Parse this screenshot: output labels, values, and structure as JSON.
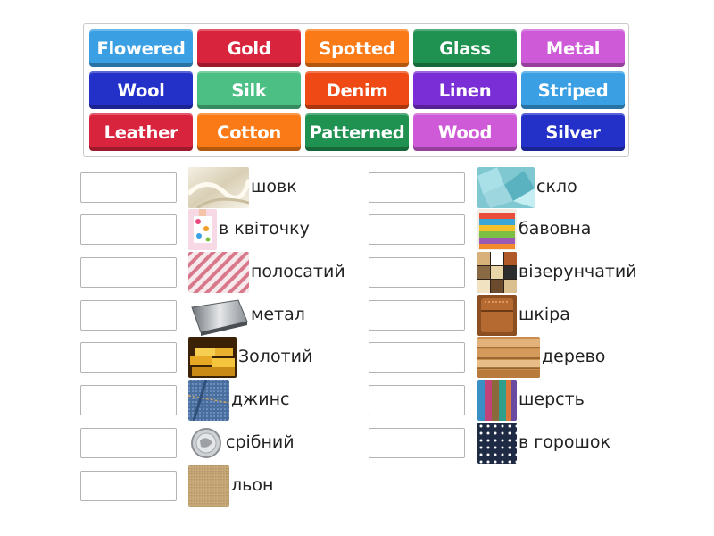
{
  "tiles": [
    {
      "label": "Flowered",
      "color": "#3aa0e3"
    },
    {
      "label": "Gold",
      "color": "#d8243c"
    },
    {
      "label": "Spotted",
      "color": "#f97a16"
    },
    {
      "label": "Glass",
      "color": "#1f9150"
    },
    {
      "label": "Metal",
      "color": "#cf5ad8"
    },
    {
      "label": "Wool",
      "color": "#2331c9"
    },
    {
      "label": "Silk",
      "color": "#4cbf85"
    },
    {
      "label": "Denim",
      "color": "#ef4a15"
    },
    {
      "label": "Linen",
      "color": "#7a2fd6"
    },
    {
      "label": "Striped",
      "color": "#3aa0e3"
    },
    {
      "label": "Leather",
      "color": "#d8243c"
    },
    {
      "label": "Cotton",
      "color": "#f97a16"
    },
    {
      "label": "Patterned",
      "color": "#1f9150"
    },
    {
      "label": "Wood",
      "color": "#cf5ad8"
    },
    {
      "label": "Silver",
      "color": "#2331c9"
    }
  ],
  "left_items": [
    {
      "label": "шовк",
      "image": "silk-image"
    },
    {
      "label": "в квіточку",
      "image": "flowered-image"
    },
    {
      "label": "полосатий",
      "image": "striped-image"
    },
    {
      "label": "метал",
      "image": "metal-image"
    },
    {
      "label": "Золотий",
      "image": "gold-image"
    },
    {
      "label": "джинс",
      "image": "denim-image"
    },
    {
      "label": "срібний",
      "image": "silver-image"
    },
    {
      "label": "льон",
      "image": "linen-image"
    }
  ],
  "right_items": [
    {
      "label": "скло",
      "image": "glass-image"
    },
    {
      "label": "бавовна",
      "image": "cotton-image"
    },
    {
      "label": "візерунчатий",
      "image": "patterned-image"
    },
    {
      "label": "шкіра",
      "image": "leather-image"
    },
    {
      "label": "дерево",
      "image": "wood-image"
    },
    {
      "label": "шерсть",
      "image": "wool-image"
    },
    {
      "label": "в горошок",
      "image": "spotted-image"
    }
  ]
}
